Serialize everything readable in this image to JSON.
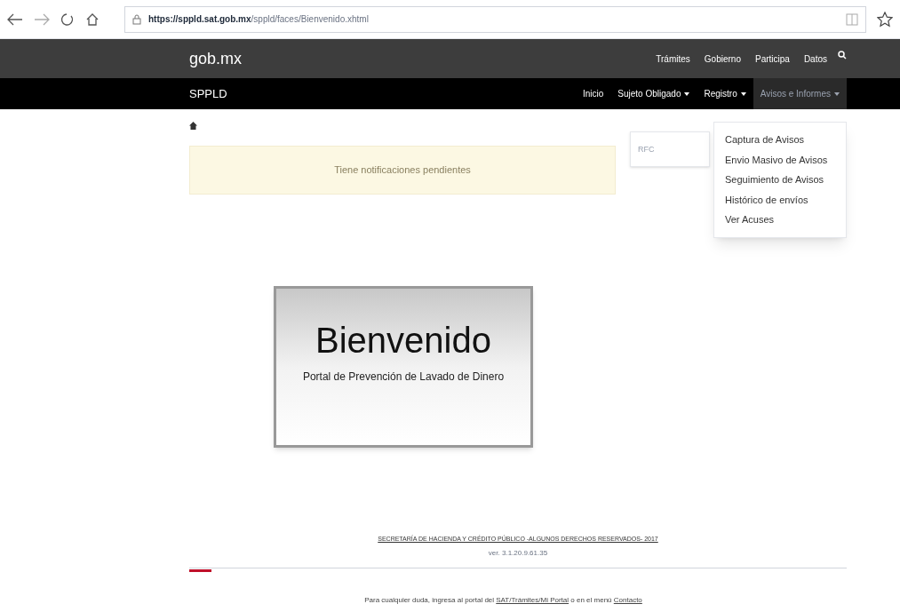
{
  "browser": {
    "url_host": "https://sppld.sat.gob.mx",
    "url_path": "/sppld/faces/Bienvenido.xhtml"
  },
  "top_bar": {
    "brand": "gob.mx",
    "links": [
      "Trámites",
      "Gobierno",
      "Participa",
      "Datos"
    ]
  },
  "nav_bar": {
    "brand": "SPPLD",
    "items": [
      {
        "label": "Inicio",
        "dropdown": false,
        "selected": false
      },
      {
        "label": "Sujeto Obligado",
        "dropdown": true,
        "selected": false
      },
      {
        "label": "Registro",
        "dropdown": true,
        "selected": false
      },
      {
        "label": "Avisos e Informes",
        "dropdown": true,
        "selected": true
      }
    ]
  },
  "dropdown_menu": [
    "Captura de Avisos",
    "Envio Masivo de Avisos",
    "Seguimiento de Avisos",
    "Histórico de envíos",
    "Ver Acuses"
  ],
  "alert": "Tiene notificaciones pendientes",
  "rfc_field": {
    "placeholder": "RFC"
  },
  "welcome": {
    "title": "Bienvenido",
    "subtitle": "Portal de Prevención de Lavado de Dinero"
  },
  "footer": {
    "copyright": "SECRETARÍA DE HACIENDA Y CRÉDITO PÚBLICO -ALGUNOS DERECHOS RESERVADOS- 2017",
    "version": "ver. 3.1.20.9.61.35"
  },
  "help": {
    "before": "Para cualquier duda, ingresa al portal del",
    "link": "SAT/Trámites/Mi Portal",
    "middle": "o en el menú",
    "contact": "Contacto"
  }
}
